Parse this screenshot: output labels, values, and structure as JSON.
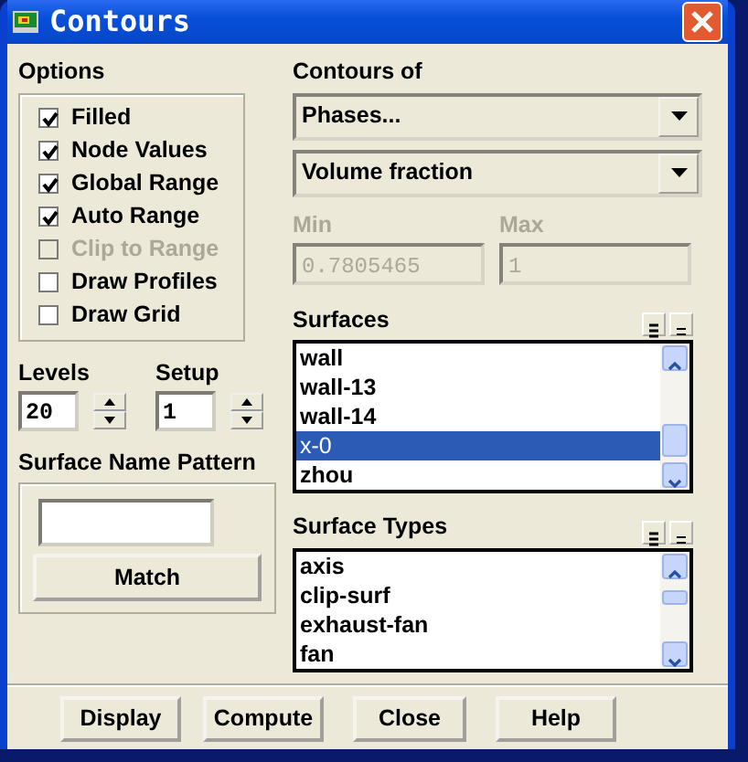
{
  "window": {
    "title": "Contours"
  },
  "options": {
    "label": "Options",
    "items": [
      {
        "label": "Filled",
        "checked": true,
        "disabled": false
      },
      {
        "label": "Node Values",
        "checked": true,
        "disabled": false
      },
      {
        "label": "Global Range",
        "checked": true,
        "disabled": false
      },
      {
        "label": "Auto Range",
        "checked": true,
        "disabled": false
      },
      {
        "label": "Clip to Range",
        "checked": false,
        "disabled": true
      },
      {
        "label": "Draw Profiles",
        "checked": false,
        "disabled": false
      },
      {
        "label": "Draw Grid",
        "checked": false,
        "disabled": false
      }
    ]
  },
  "spinners": [
    {
      "label": "Levels",
      "value": "20"
    },
    {
      "label": "Setup",
      "value": "1"
    }
  ],
  "pattern": {
    "label": "Surface Name Pattern",
    "button": "Match"
  },
  "contours_of": {
    "label": "Contours of",
    "dropdowns": [
      "Phases...",
      "Volume fraction"
    ]
  },
  "range": [
    {
      "label": "Min",
      "value": "0.7805465",
      "disabled": true
    },
    {
      "label": "Max",
      "value": "1",
      "disabled": true
    }
  ],
  "lists": [
    {
      "label": "Surfaces",
      "items": [
        {
          "text": "wall",
          "selected": false
        },
        {
          "text": "wall-13",
          "selected": false
        },
        {
          "text": "wall-14",
          "selected": false
        },
        {
          "text": "x-0",
          "selected": true
        },
        {
          "text": "zhou",
          "selected": false
        }
      ]
    },
    {
      "label": "Surface Types",
      "items": [
        {
          "text": "axis",
          "selected": false
        },
        {
          "text": "clip-surf",
          "selected": false
        },
        {
          "text": "exhaust-fan",
          "selected": false
        },
        {
          "text": "fan",
          "selected": false
        }
      ]
    }
  ],
  "buttons": [
    "Display",
    "Compute",
    "Close",
    "Help"
  ]
}
